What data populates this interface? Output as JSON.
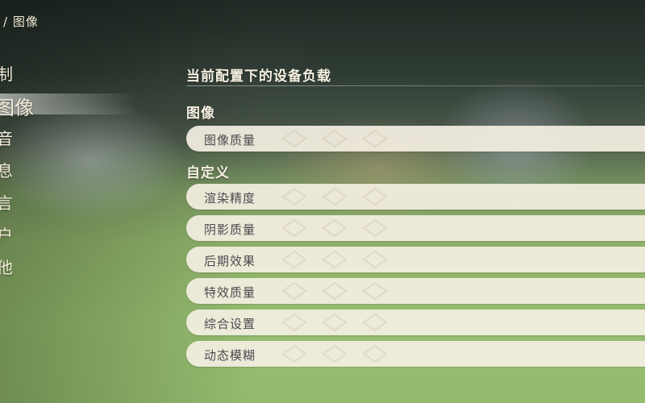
{
  "breadcrumb": "/ 图像",
  "side_menu": {
    "items": [
      {
        "label": "制",
        "active": false
      },
      {
        "label": "图像",
        "active": true
      },
      {
        "label": "音",
        "active": false
      },
      {
        "label": "息",
        "active": false
      },
      {
        "label": "言",
        "active": false
      },
      {
        "label": "户",
        "active": false
      },
      {
        "label": "他",
        "active": false
      }
    ]
  },
  "main": {
    "load_title": "当前配置下的设备负载",
    "image_section": {
      "title": "图像",
      "rows": [
        {
          "label": "图像质量"
        }
      ]
    },
    "custom_section": {
      "title": "自定义",
      "rows": [
        {
          "label": "渲染精度"
        },
        {
          "label": "阴影质量"
        },
        {
          "label": "后期效果"
        },
        {
          "label": "特效质量"
        },
        {
          "label": "综合设置"
        },
        {
          "label": "动态模糊"
        }
      ]
    }
  },
  "colors": {
    "row_background": "#f3eee1",
    "row_text": "#4b4a4e",
    "title_text": "#f6f0e1"
  }
}
